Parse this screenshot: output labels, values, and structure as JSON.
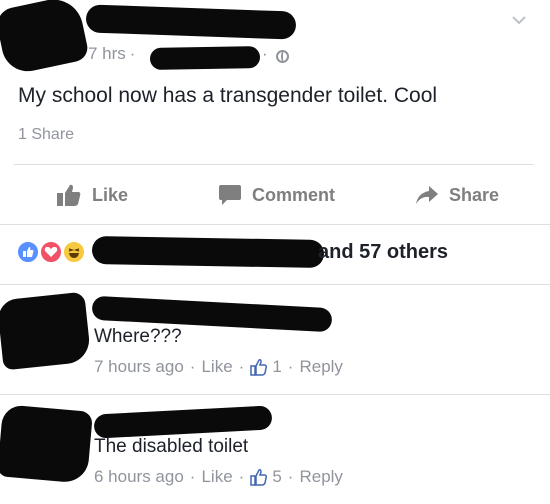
{
  "post": {
    "time": "7 hrs",
    "separator": "·",
    "text": "My school now has a transgender toilet. Cool",
    "share_count": "1 Share"
  },
  "actions": {
    "like": "Like",
    "comment": "Comment",
    "share": "Share"
  },
  "reactions": {
    "others_text": "and 57 others"
  },
  "comments": [
    {
      "text": "Where???",
      "time": "7 hours ago",
      "like_label": "Like",
      "like_count": "1",
      "reply_label": "Reply"
    },
    {
      "text": "The disabled toilet",
      "time": "6 hours ago",
      "like_label": "Like",
      "like_count": "5",
      "reply_label": "Reply"
    }
  ],
  "colors": {
    "text_primary": "#1d2129",
    "text_secondary": "#90949c",
    "action_gray": "#7f7f7f",
    "like_blue": "#5890ff",
    "love_red": "#f25268",
    "haha_yellow": "#f7c940",
    "divider": "#dddfe2",
    "redaction": "#0a0a0a"
  },
  "icons": {
    "privacy": "globe-icon",
    "menu": "chevron-down-icon",
    "like": "thumbs-up-icon",
    "comment": "speech-bubble-icon",
    "share": "share-arrow-icon"
  }
}
